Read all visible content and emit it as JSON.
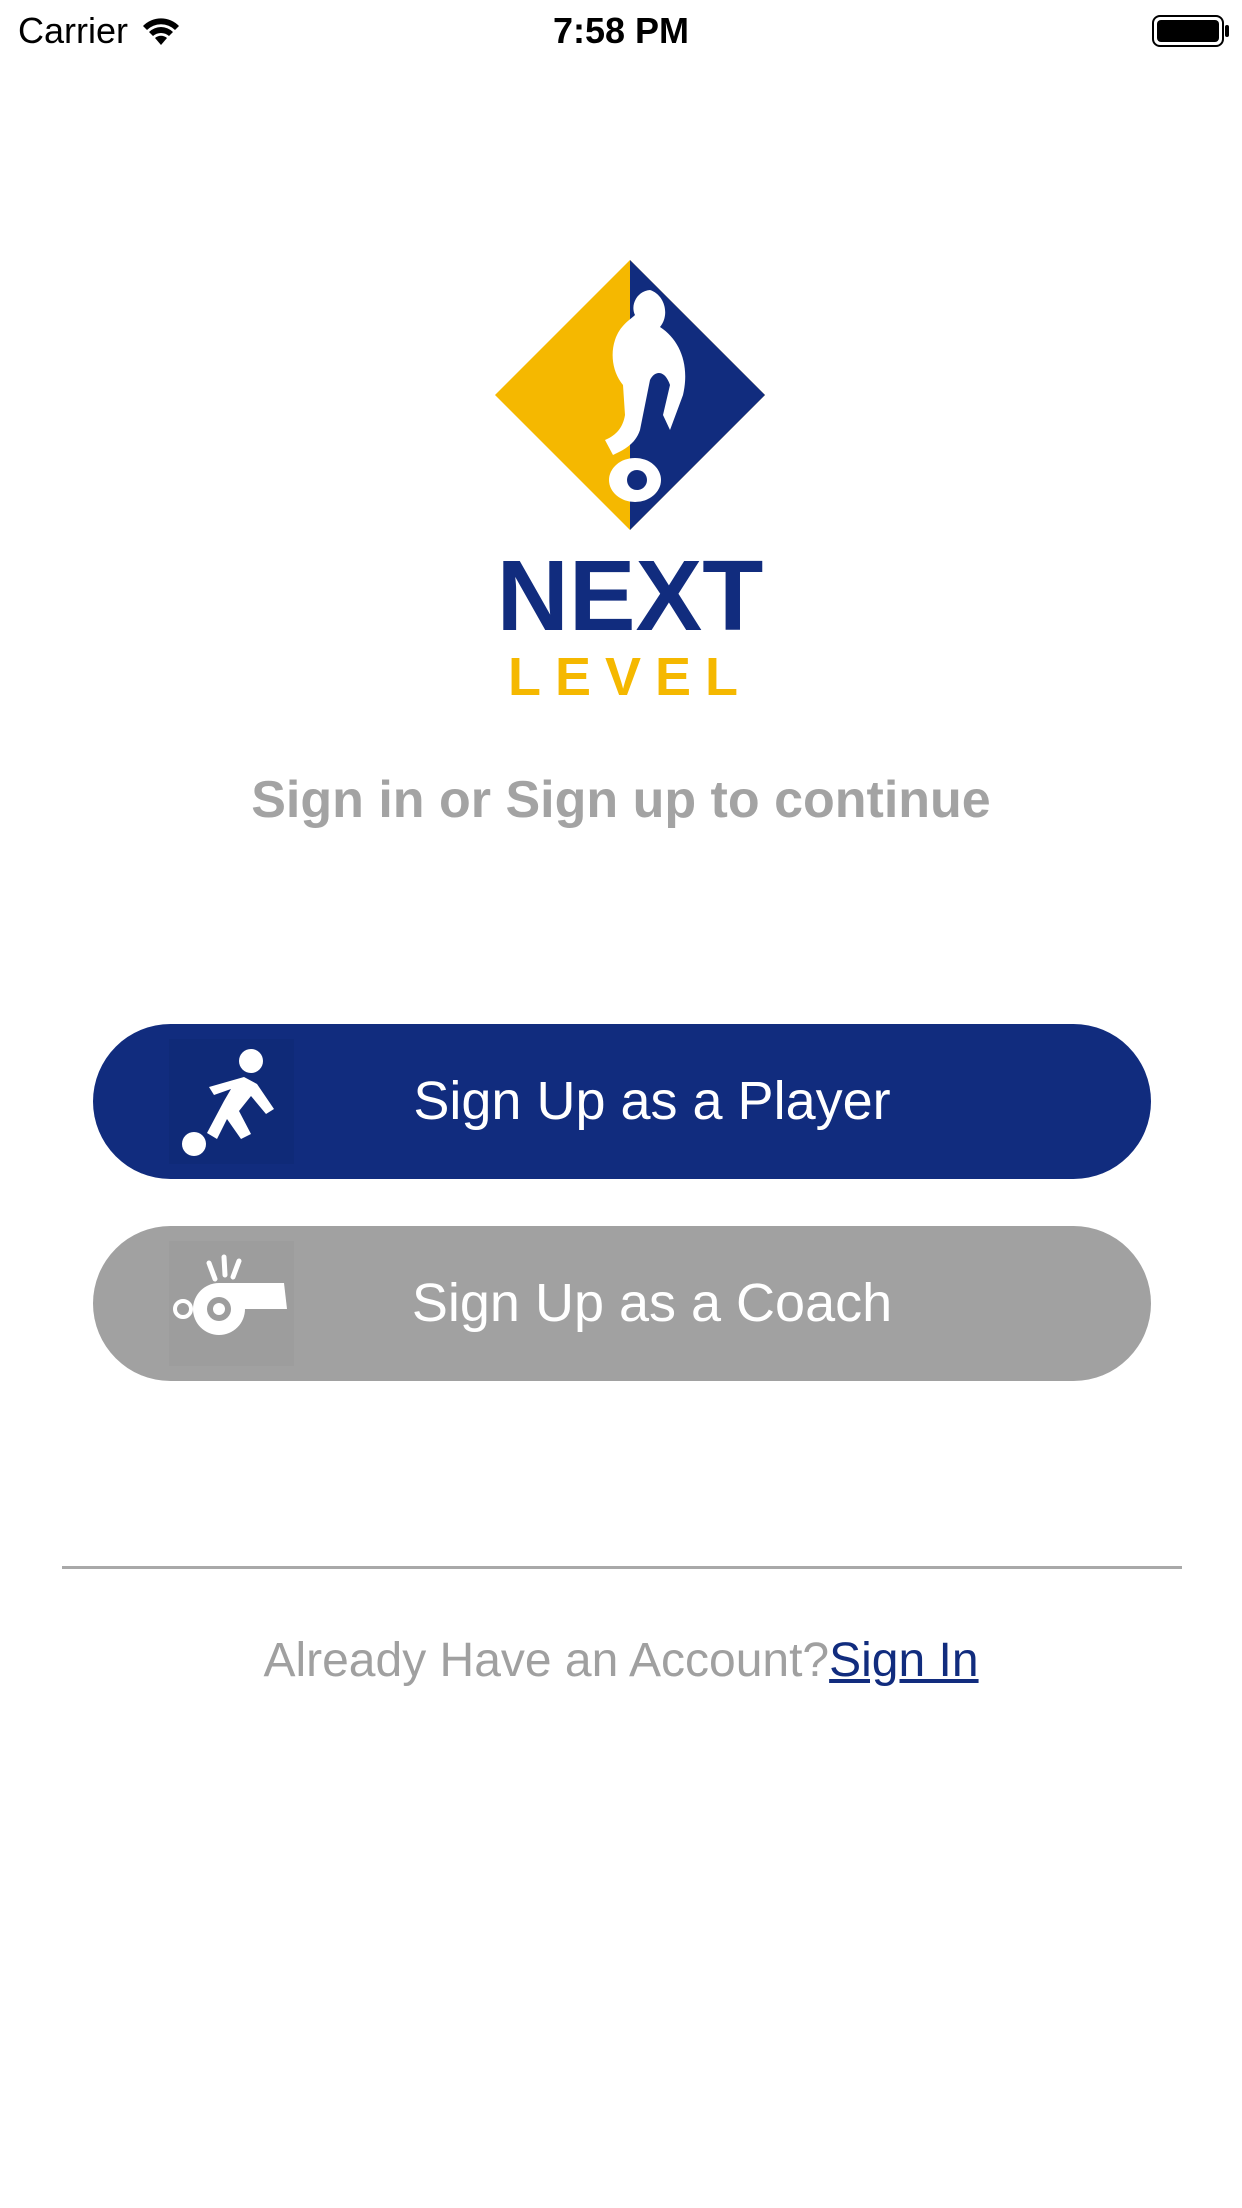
{
  "status_bar": {
    "carrier": "Carrier",
    "time": "7:58 PM"
  },
  "logo": {
    "word1": "NEXT",
    "word2": "LEVEL"
  },
  "subtitle": "Sign in or Sign up to continue",
  "buttons": {
    "player": {
      "label": "Sign Up as a Player",
      "icon": "soccer-player-icon",
      "color": "#112c7e"
    },
    "coach": {
      "label": "Sign Up as a Coach",
      "icon": "whistle-icon",
      "color": "#a1a1a1"
    }
  },
  "footer": {
    "prompt": "Already Have an Account?",
    "link": "Sign In"
  },
  "colors": {
    "brand_blue": "#112c7e",
    "brand_yellow": "#f5b800",
    "muted_gray": "#a3a3a3"
  }
}
